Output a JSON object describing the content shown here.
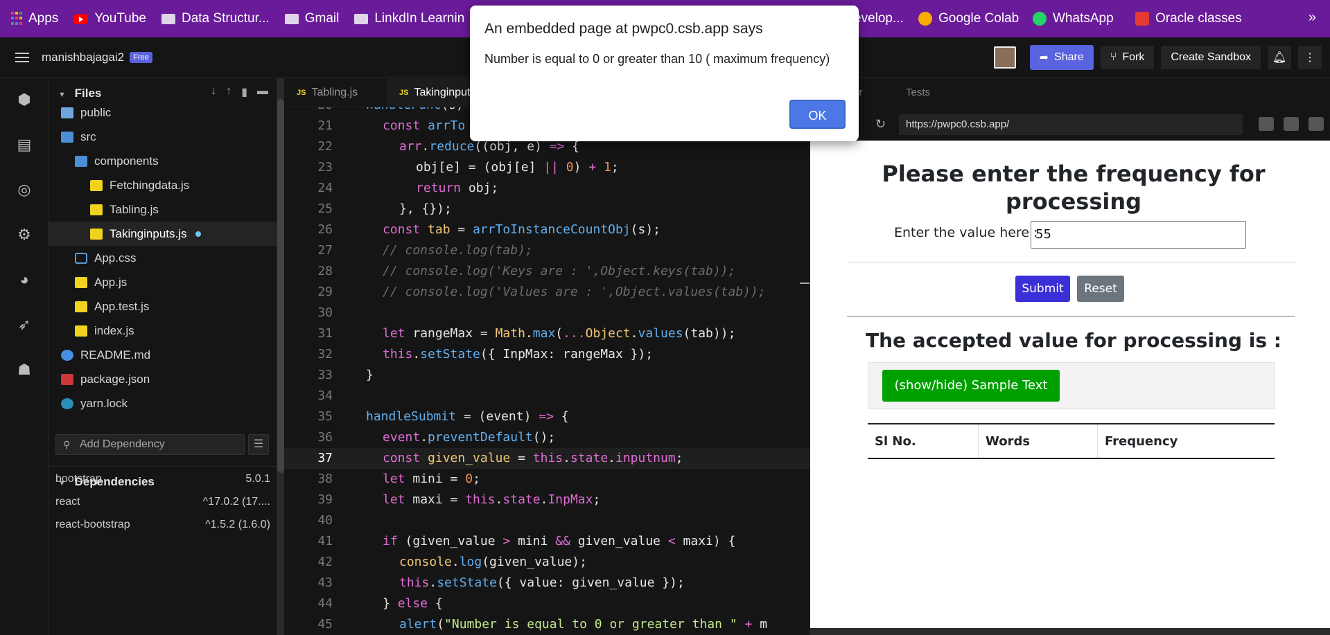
{
  "bookmarks": [
    {
      "label": "Apps",
      "icon": "apps-icon"
    },
    {
      "label": "YouTube",
      "icon": "youtube-icon"
    },
    {
      "label": "Data Structur...",
      "icon": "folder-icon"
    },
    {
      "label": "Gmail",
      "icon": "folder-icon"
    },
    {
      "label": "LinkdIn Learnin",
      "icon": "folder-icon"
    },
    {
      "label": "evelop...",
      "icon": "none"
    },
    {
      "label": "Google Colab",
      "icon": "colab-icon"
    },
    {
      "label": "WhatsApp",
      "icon": "whatsapp-icon"
    },
    {
      "label": "Oracle classes",
      "icon": "oracle-icon"
    }
  ],
  "bookmarks_more": "»",
  "header": {
    "username": "manishbajagai2",
    "plan_badge": "Free",
    "share_label": "Share",
    "fork_label": "Fork",
    "create_label": "Create Sandbox"
  },
  "explorer": {
    "title": "Files",
    "items": [
      {
        "label": "public",
        "type": "folder"
      },
      {
        "label": "src",
        "type": "folder-open"
      },
      {
        "label": "components",
        "type": "folder-open"
      },
      {
        "label": "Fetchingdata.js",
        "type": "js"
      },
      {
        "label": "Tabling.js",
        "type": "js"
      },
      {
        "label": "Takinginputs.js",
        "type": "js"
      },
      {
        "label": "App.css",
        "type": "css"
      },
      {
        "label": "App.js",
        "type": "js"
      },
      {
        "label": "App.test.js",
        "type": "js"
      },
      {
        "label": "index.js",
        "type": "js"
      },
      {
        "label": "README.md",
        "type": "info"
      },
      {
        "label": "package.json",
        "type": "pkg"
      },
      {
        "label": "yarn.lock",
        "type": "yarn"
      }
    ],
    "dependencies_title": "Dependencies",
    "dependency_placeholder": "Add Dependency",
    "dependencies": [
      {
        "name": "bootstrap",
        "version": "5.0.1"
      },
      {
        "name": "react",
        "version": "^17.0.2 (17...."
      },
      {
        "name": "react-bootstrap",
        "version": "^1.5.2 (1.6.0)"
      }
    ]
  },
  "editor": {
    "tabs": [
      {
        "label": "Tabling.js",
        "active": false
      },
      {
        "label": "Takinginput",
        "active": true
      }
    ],
    "current_line": "37"
  },
  "preview": {
    "tab_fragment": "er",
    "tests_tab": "Tests",
    "url": "https://pwpc0.csb.app/",
    "page": {
      "title": "Please enter the frequency for processing",
      "input_label": "Enter the value here :",
      "input_value": "55",
      "submit_label": "Submit",
      "reset_label": "Reset",
      "accepted_heading": "The accepted value for processing is :",
      "sample_button": "(show/hide) Sample Text",
      "table_headers": [
        "Sl No.",
        "Words",
        "Frequency"
      ]
    }
  },
  "dialog": {
    "title": "An embedded page at pwpc0.csb.app says",
    "message": "Number is equal to 0 or greater than 10 ( maximum frequency)",
    "ok_label": "OK"
  }
}
